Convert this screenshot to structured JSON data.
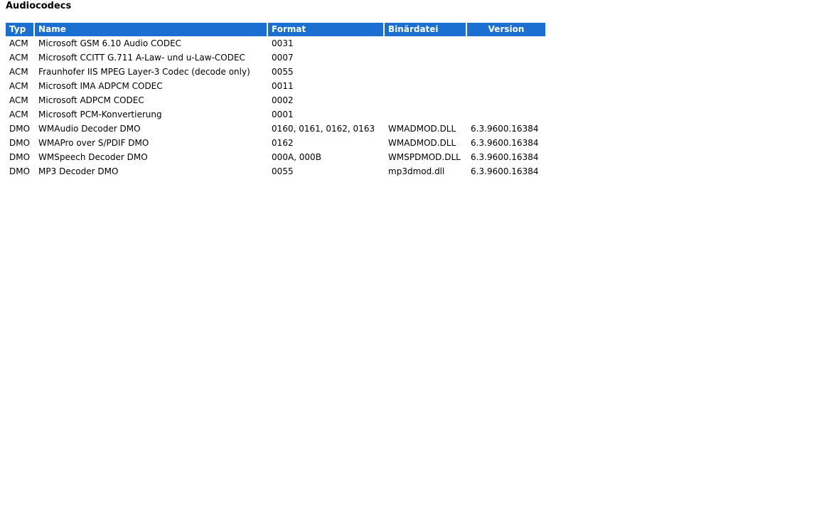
{
  "page": {
    "title": "Audiocodecs"
  },
  "table": {
    "headers": {
      "typ": "Typ",
      "name": "Name",
      "format": "Format",
      "binary": "Binärdatei",
      "version": "Version"
    },
    "header_color": "#1a6fd0",
    "rows": [
      {
        "typ": "ACM",
        "name": "Microsoft GSM 6.10 Audio CODEC",
        "format": "0031",
        "binary": "",
        "version": ""
      },
      {
        "typ": "ACM",
        "name": "Microsoft CCITT G.711 A-Law- und u-Law-CODEC",
        "format": "0007",
        "binary": "",
        "version": ""
      },
      {
        "typ": "ACM",
        "name": "Fraunhofer IIS MPEG Layer-3 Codec (decode only)",
        "format": "0055",
        "binary": "",
        "version": ""
      },
      {
        "typ": "ACM",
        "name": "Microsoft IMA ADPCM CODEC",
        "format": "0011",
        "binary": "",
        "version": ""
      },
      {
        "typ": "ACM",
        "name": "Microsoft ADPCM CODEC",
        "format": "0002",
        "binary": "",
        "version": ""
      },
      {
        "typ": "ACM",
        "name": "Microsoft PCM-Konvertierung",
        "format": "0001",
        "binary": "",
        "version": ""
      },
      {
        "typ": "DMO",
        "name": "WMAudio Decoder DMO",
        "format": "0160, 0161, 0162, 0163",
        "binary": "WMADMOD.DLL",
        "version": "6.3.9600.16384"
      },
      {
        "typ": "DMO",
        "name": "WMAPro over S/PDIF DMO",
        "format": "0162",
        "binary": "WMADMOD.DLL",
        "version": "6.3.9600.16384"
      },
      {
        "typ": "DMO",
        "name": "WMSpeech Decoder DMO",
        "format": "000A, 000B",
        "binary": "WMSPDMOD.DLL",
        "version": "6.3.9600.16384"
      },
      {
        "typ": "DMO",
        "name": "MP3 Decoder DMO",
        "format": "0055",
        "binary": "mp3dmod.dll",
        "version": "6.3.9600.16384"
      }
    ]
  }
}
